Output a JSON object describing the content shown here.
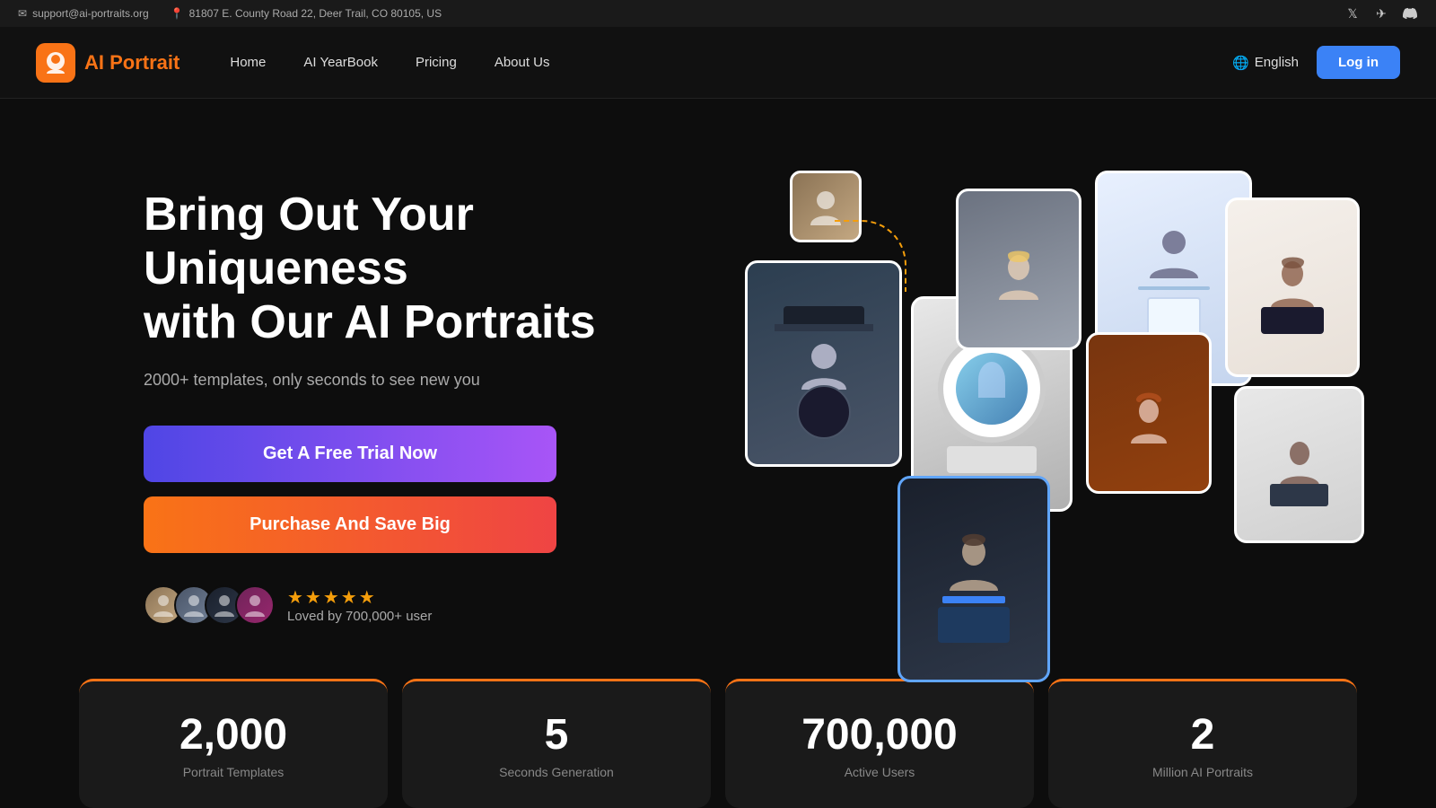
{
  "topbar": {
    "email": "support@ai-portraits.org",
    "address": "81807 E. County Road 22, Deer Trail, CO 80105, US",
    "email_icon": "✉",
    "location_icon": "📍"
  },
  "navbar": {
    "logo_text": "AI Portrait",
    "logo_icon": "👤",
    "nav_links": [
      {
        "label": "Home",
        "id": "home"
      },
      {
        "label": "AI YearBook",
        "id": "yearbook"
      },
      {
        "label": "Pricing",
        "id": "pricing"
      },
      {
        "label": "About Us",
        "id": "about"
      }
    ],
    "language_label": "English",
    "login_label": "Log in"
  },
  "hero": {
    "title_line1": "Bring Out Your Uniqueness",
    "title_line2": "with Our AI Portraits",
    "subtitle": "2000+ templates, only seconds to see new you",
    "btn_trial": "Get A Free Trial Now",
    "btn_purchase": "Purchase And Save Big",
    "loved_text": "Loved by 700,000+ user",
    "stars": "★★★★★"
  },
  "stats": [
    {
      "number": "2,000",
      "label": "Portrait Templates"
    },
    {
      "number": "5",
      "label": "Seconds Generation"
    },
    {
      "number": "700,000",
      "label": "Active Users"
    },
    {
      "number": "2",
      "label": "Million AI Portraits"
    }
  ],
  "social_icons": [
    "𝕏",
    "✈",
    "⬡"
  ],
  "colors": {
    "accent_orange": "#f97316",
    "accent_blue": "#3b82f6",
    "trial_gradient_start": "#4f46e5",
    "trial_gradient_end": "#a855f7",
    "purchase_gradient_start": "#f97316",
    "purchase_gradient_end": "#ef4444"
  }
}
